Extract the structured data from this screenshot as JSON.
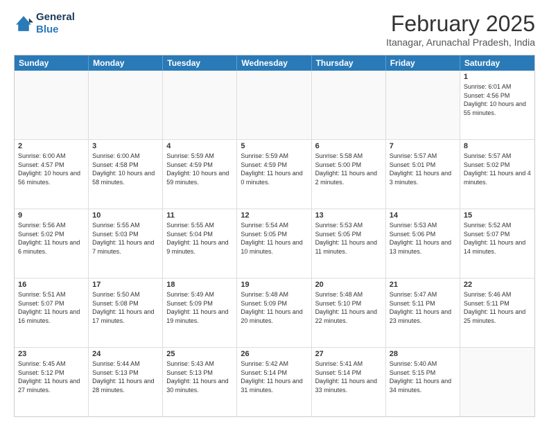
{
  "header": {
    "logo": {
      "line1": "General",
      "line2": "Blue"
    },
    "title": "February 2025",
    "subtitle": "Itanagar, Arunachal Pradesh, India"
  },
  "weekdays": [
    "Sunday",
    "Monday",
    "Tuesday",
    "Wednesday",
    "Thursday",
    "Friday",
    "Saturday"
  ],
  "weeks": [
    [
      {
        "day": "",
        "empty": true
      },
      {
        "day": "",
        "empty": true
      },
      {
        "day": "",
        "empty": true
      },
      {
        "day": "",
        "empty": true
      },
      {
        "day": "",
        "empty": true
      },
      {
        "day": "",
        "empty": true
      },
      {
        "day": "1",
        "sunrise": "6:01 AM",
        "sunset": "4:56 PM",
        "daylight": "10 hours and 55 minutes."
      }
    ],
    [
      {
        "day": "2",
        "sunrise": "6:00 AM",
        "sunset": "4:57 PM",
        "daylight": "10 hours and 56 minutes."
      },
      {
        "day": "3",
        "sunrise": "6:00 AM",
        "sunset": "4:58 PM",
        "daylight": "10 hours and 58 minutes."
      },
      {
        "day": "4",
        "sunrise": "5:59 AM",
        "sunset": "4:59 PM",
        "daylight": "10 hours and 59 minutes."
      },
      {
        "day": "5",
        "sunrise": "5:59 AM",
        "sunset": "4:59 PM",
        "daylight": "11 hours and 0 minutes."
      },
      {
        "day": "6",
        "sunrise": "5:58 AM",
        "sunset": "5:00 PM",
        "daylight": "11 hours and 2 minutes."
      },
      {
        "day": "7",
        "sunrise": "5:57 AM",
        "sunset": "5:01 PM",
        "daylight": "11 hours and 3 minutes."
      },
      {
        "day": "8",
        "sunrise": "5:57 AM",
        "sunset": "5:02 PM",
        "daylight": "11 hours and 4 minutes."
      }
    ],
    [
      {
        "day": "9",
        "sunrise": "5:56 AM",
        "sunset": "5:02 PM",
        "daylight": "11 hours and 6 minutes."
      },
      {
        "day": "10",
        "sunrise": "5:55 AM",
        "sunset": "5:03 PM",
        "daylight": "11 hours and 7 minutes."
      },
      {
        "day": "11",
        "sunrise": "5:55 AM",
        "sunset": "5:04 PM",
        "daylight": "11 hours and 9 minutes."
      },
      {
        "day": "12",
        "sunrise": "5:54 AM",
        "sunset": "5:05 PM",
        "daylight": "11 hours and 10 minutes."
      },
      {
        "day": "13",
        "sunrise": "5:53 AM",
        "sunset": "5:05 PM",
        "daylight": "11 hours and 11 minutes."
      },
      {
        "day": "14",
        "sunrise": "5:53 AM",
        "sunset": "5:06 PM",
        "daylight": "11 hours and 13 minutes."
      },
      {
        "day": "15",
        "sunrise": "5:52 AM",
        "sunset": "5:07 PM",
        "daylight": "11 hours and 14 minutes."
      }
    ],
    [
      {
        "day": "16",
        "sunrise": "5:51 AM",
        "sunset": "5:07 PM",
        "daylight": "11 hours and 16 minutes."
      },
      {
        "day": "17",
        "sunrise": "5:50 AM",
        "sunset": "5:08 PM",
        "daylight": "11 hours and 17 minutes."
      },
      {
        "day": "18",
        "sunrise": "5:49 AM",
        "sunset": "5:09 PM",
        "daylight": "11 hours and 19 minutes."
      },
      {
        "day": "19",
        "sunrise": "5:48 AM",
        "sunset": "5:09 PM",
        "daylight": "11 hours and 20 minutes."
      },
      {
        "day": "20",
        "sunrise": "5:48 AM",
        "sunset": "5:10 PM",
        "daylight": "11 hours and 22 minutes."
      },
      {
        "day": "21",
        "sunrise": "5:47 AM",
        "sunset": "5:11 PM",
        "daylight": "11 hours and 23 minutes."
      },
      {
        "day": "22",
        "sunrise": "5:46 AM",
        "sunset": "5:11 PM",
        "daylight": "11 hours and 25 minutes."
      }
    ],
    [
      {
        "day": "23",
        "sunrise": "5:45 AM",
        "sunset": "5:12 PM",
        "daylight": "11 hours and 27 minutes."
      },
      {
        "day": "24",
        "sunrise": "5:44 AM",
        "sunset": "5:13 PM",
        "daylight": "11 hours and 28 minutes."
      },
      {
        "day": "25",
        "sunrise": "5:43 AM",
        "sunset": "5:13 PM",
        "daylight": "11 hours and 30 minutes."
      },
      {
        "day": "26",
        "sunrise": "5:42 AM",
        "sunset": "5:14 PM",
        "daylight": "11 hours and 31 minutes."
      },
      {
        "day": "27",
        "sunrise": "5:41 AM",
        "sunset": "5:14 PM",
        "daylight": "11 hours and 33 minutes."
      },
      {
        "day": "28",
        "sunrise": "5:40 AM",
        "sunset": "5:15 PM",
        "daylight": "11 hours and 34 minutes."
      },
      {
        "day": "",
        "empty": true
      }
    ]
  ]
}
